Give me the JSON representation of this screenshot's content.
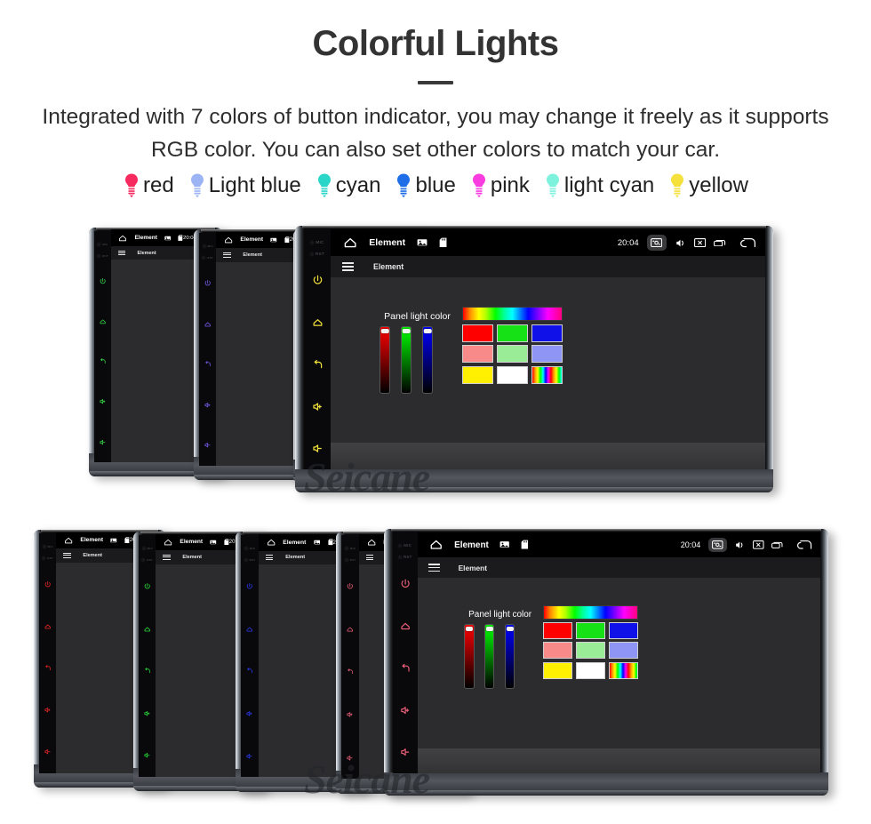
{
  "header": {
    "title": "Colorful Lights",
    "subtitle": "Integrated with 7 colors of button indicator, you may change it freely as it supports RGB color. You can also set other colors to match your car."
  },
  "legend": {
    "items": [
      {
        "label": "red",
        "color": "#f72a5f"
      },
      {
        "label": "Light blue",
        "color": "#9db4f4"
      },
      {
        "label": "cyan",
        "color": "#2ad6c8"
      },
      {
        "label": "blue",
        "color": "#1f6ee8"
      },
      {
        "label": "pink",
        "color": "#f93ce0"
      },
      {
        "label": "light cyan",
        "color": "#7ff2dd"
      },
      {
        "label": "yellow",
        "color": "#f5e03c"
      }
    ]
  },
  "device": {
    "statusbar": {
      "home_icon": "home-icon",
      "title": "Element",
      "gallery_icon": "gallery-icon",
      "sdcard_icon": "sdcard-icon",
      "clock": "20:04",
      "screenshot_icon": "screenshot-icon",
      "volume_icon": "volume-icon",
      "close_icon": "close-window-icon",
      "recents_icon": "recents-icon",
      "back_icon": "back-arrow-icon"
    },
    "appbar": {
      "menu_icon": "hamburger-menu-icon",
      "title": "Element"
    },
    "content": {
      "panel_label": "Panel light color",
      "sliders": [
        {
          "name": "red-slider",
          "color": "#ff0000",
          "value": 100
        },
        {
          "name": "green-slider",
          "color": "#00ff00",
          "value": 100
        },
        {
          "name": "blue-slider",
          "color": "#0000ff",
          "value": 100
        }
      ],
      "swatches": [
        {
          "name": "rainbow-gradient-swatch",
          "type": "rainbow",
          "color": ""
        },
        {
          "name": "red-swatch",
          "type": "solid",
          "color": "#ff0000"
        },
        {
          "name": "green-swatch",
          "type": "solid",
          "color": "#16e016"
        },
        {
          "name": "blue-swatch",
          "type": "solid",
          "color": "#1010e8"
        },
        {
          "name": "salmon-swatch",
          "type": "solid",
          "color": "#f98a8a"
        },
        {
          "name": "lightgreen-swatch",
          "type": "solid",
          "color": "#9aec96"
        },
        {
          "name": "periwinkle-swatch",
          "type": "solid",
          "color": "#8f95f5"
        },
        {
          "name": "yellow-swatch",
          "type": "solid",
          "color": "#ffef00"
        },
        {
          "name": "white-swatch",
          "type": "solid",
          "color": "#ffffff"
        },
        {
          "name": "rainbow-stripe-swatch",
          "type": "stripe",
          "color": ""
        }
      ]
    },
    "rail": {
      "mic_label": "MIC",
      "rst_label": "RST",
      "buttons": [
        "power-button",
        "home-button",
        "back-button",
        "volume-up-button",
        "volume-down-button"
      ]
    }
  },
  "rows": {
    "top": {
      "units": [
        {
          "name": "unit-top-1",
          "led_color": "#36e04a"
        },
        {
          "name": "unit-top-2",
          "led_color": "#7a5cf0"
        },
        {
          "name": "unit-top-3",
          "led_color": "#f2e23a"
        }
      ]
    },
    "bottom": {
      "units": [
        {
          "name": "unit-bottom-1",
          "led_color": "#ef2626"
        },
        {
          "name": "unit-bottom-2",
          "led_color": "#2ae23a"
        },
        {
          "name": "unit-bottom-3",
          "led_color": "#2b3bf0"
        },
        {
          "name": "unit-bottom-4",
          "led_color": "#f0607a"
        }
      ]
    }
  },
  "watermark": {
    "text": "Seicane"
  }
}
